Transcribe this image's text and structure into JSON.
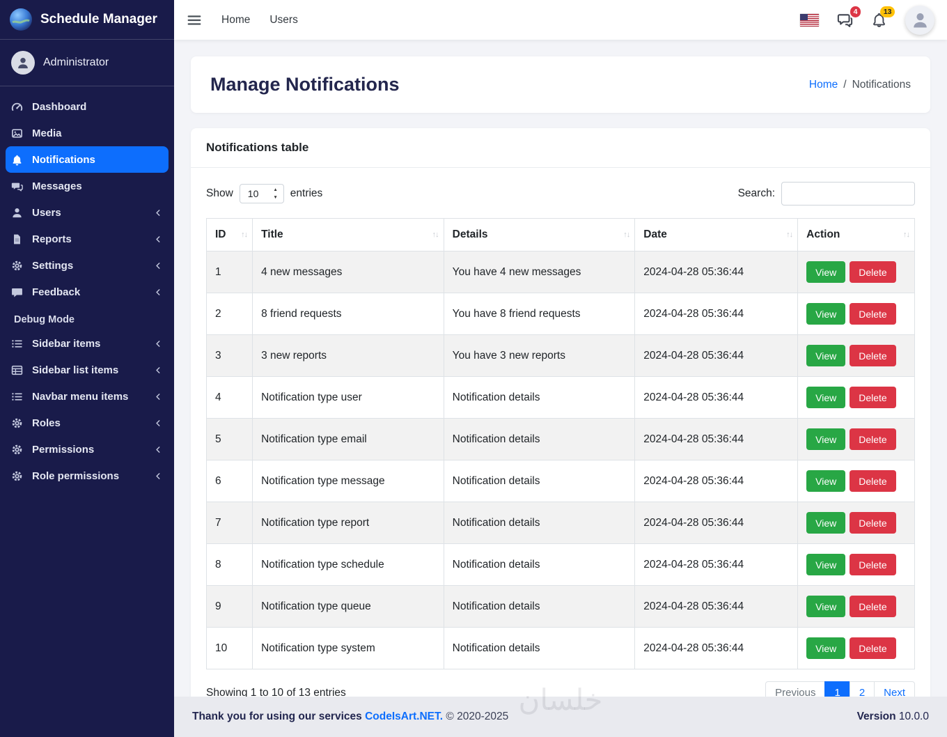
{
  "brand": {
    "title": "Schedule Manager"
  },
  "sidebar": {
    "user": "Administrator",
    "items": [
      {
        "label": "Dashboard",
        "icon": "gauge-icon"
      },
      {
        "label": "Media",
        "icon": "images-icon"
      },
      {
        "label": "Notifications",
        "icon": "bell-icon",
        "active": true
      },
      {
        "label": "Messages",
        "icon": "comments-icon"
      },
      {
        "label": "Users",
        "icon": "user-icon",
        "chevron": true
      },
      {
        "label": "Reports",
        "icon": "file-icon",
        "chevron": true
      },
      {
        "label": "Settings",
        "icon": "gear-icon",
        "chevron": true
      },
      {
        "label": "Feedback",
        "icon": "comment-icon",
        "chevron": true
      }
    ],
    "section": "Debug Mode",
    "debug_items": [
      {
        "label": "Sidebar items",
        "icon": "list-icon",
        "chevron": true
      },
      {
        "label": "Sidebar list items",
        "icon": "table-list-icon",
        "chevron": true
      },
      {
        "label": "Navbar menu items",
        "icon": "list-icon",
        "chevron": true
      },
      {
        "label": "Roles",
        "icon": "gear-icon",
        "chevron": true
      },
      {
        "label": "Permissions",
        "icon": "gear-icon",
        "chevron": true
      },
      {
        "label": "Role permissions",
        "icon": "gear-icon",
        "chevron": true
      }
    ]
  },
  "navbar": {
    "home": "Home",
    "users": "Users",
    "messages_badge": "4",
    "notifications_badge": "13"
  },
  "page": {
    "title": "Manage Notifications",
    "breadcrumb_home": "Home",
    "breadcrumb_sep": "/",
    "breadcrumb_current": "Notifications"
  },
  "table": {
    "card_title": "Notifications table",
    "show_label": "Show",
    "length_value": "10",
    "entries_label": "entries",
    "search_label": "Search:",
    "headers": [
      "ID",
      "Title",
      "Details",
      "Date",
      "Action"
    ],
    "rows": [
      {
        "id": "1",
        "title": "4 new messages",
        "details": "You have 4 new messages",
        "date": "2024-04-28 05:36:44"
      },
      {
        "id": "2",
        "title": "8 friend requests",
        "details": "You have 8 friend requests",
        "date": "2024-04-28 05:36:44"
      },
      {
        "id": "3",
        "title": "3 new reports",
        "details": "You have 3 new reports",
        "date": "2024-04-28 05:36:44"
      },
      {
        "id": "4",
        "title": "Notification type user",
        "details": "Notification details",
        "date": "2024-04-28 05:36:44"
      },
      {
        "id": "5",
        "title": "Notification type email",
        "details": "Notification details",
        "date": "2024-04-28 05:36:44"
      },
      {
        "id": "6",
        "title": "Notification type message",
        "details": "Notification details",
        "date": "2024-04-28 05:36:44"
      },
      {
        "id": "7",
        "title": "Notification type report",
        "details": "Notification details",
        "date": "2024-04-28 05:36:44"
      },
      {
        "id": "8",
        "title": "Notification type schedule",
        "details": "Notification details",
        "date": "2024-04-28 05:36:44"
      },
      {
        "id": "9",
        "title": "Notification type queue",
        "details": "Notification details",
        "date": "2024-04-28 05:36:44"
      },
      {
        "id": "10",
        "title": "Notification type system",
        "details": "Notification details",
        "date": "2024-04-28 05:36:44"
      }
    ],
    "view": "View",
    "delete": "Delete",
    "info": "Showing 1 to 10 of 13 entries",
    "pagination": {
      "prev": "Previous",
      "page1": "1",
      "page2": "2",
      "next": "Next"
    }
  },
  "footer": {
    "thanks": "Thank you for using our services",
    "brand": "CodeIsArt.NET.",
    "copyright": "© 2020-2025",
    "version_label": "Version",
    "version_value": "10.0.0",
    "watermark": "خلسان"
  },
  "colors": {
    "sidebar_bg": "#191b4a",
    "accent_blue": "#0d6efd",
    "view_green": "#28a745",
    "delete_red": "#dc3545",
    "badge_red": "#dc3545",
    "badge_yellow": "#ffc107"
  }
}
